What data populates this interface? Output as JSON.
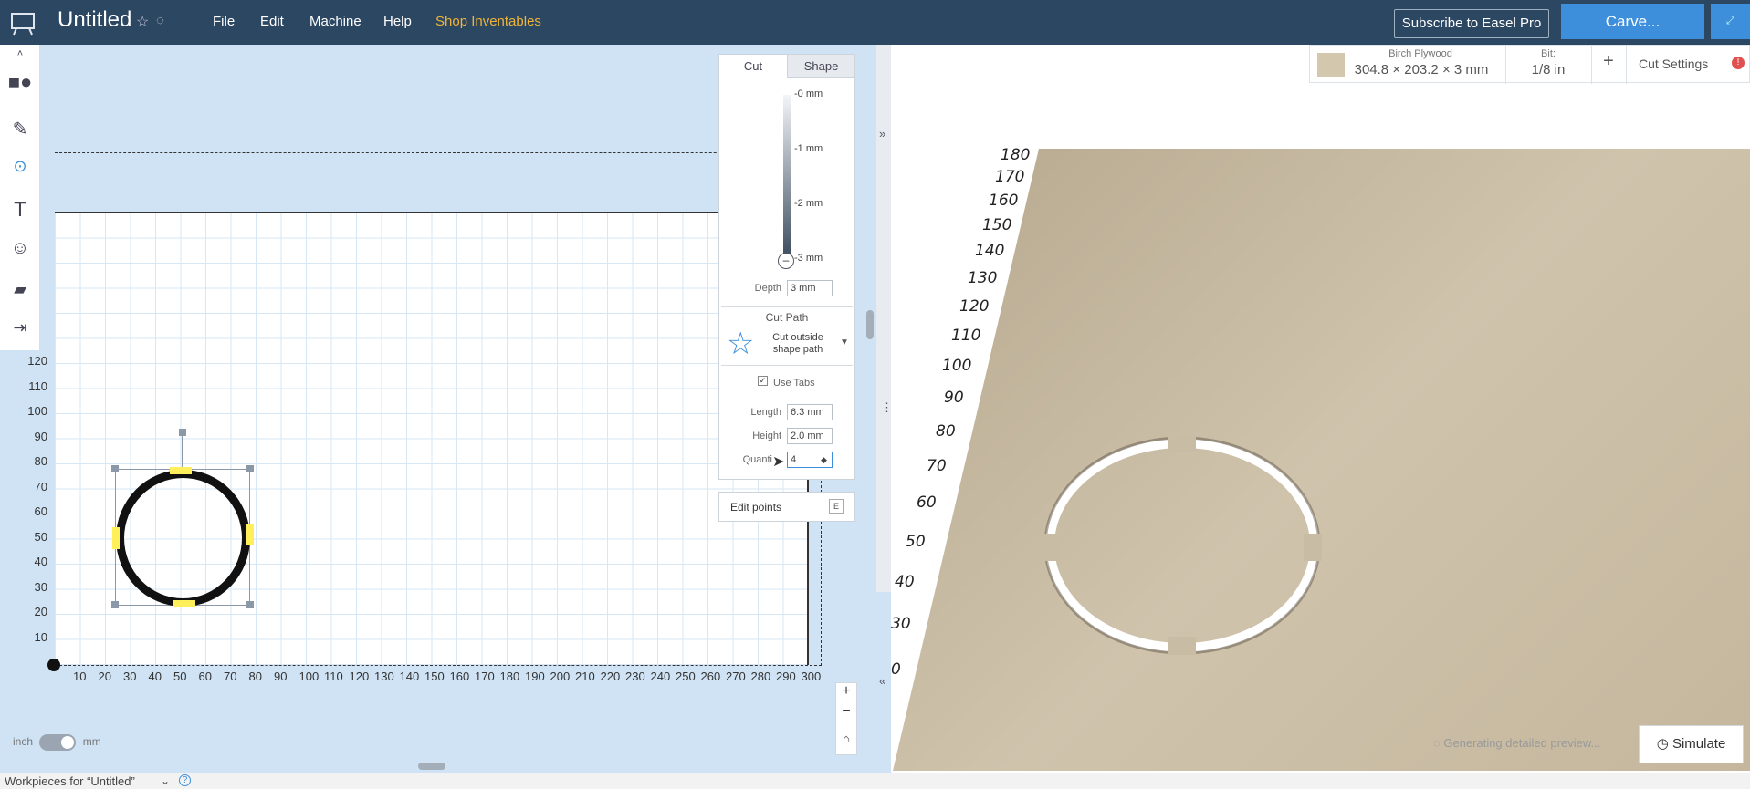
{
  "header": {
    "title": "Untitled",
    "menu": [
      "File",
      "Edit",
      "Machine",
      "Help",
      "Shop Inventables"
    ],
    "subscribe": "Subscribe to Easel Pro",
    "carve": "Carve..."
  },
  "canvas": {
    "y_ticks": [
      "120",
      "110",
      "100",
      "90",
      "80",
      "70",
      "60",
      "50",
      "40",
      "30",
      "20",
      "10"
    ],
    "x_ticks": [
      "10",
      "20",
      "30",
      "40",
      "50",
      "60",
      "70",
      "80",
      "90",
      "100",
      "110",
      "120",
      "130",
      "140",
      "150",
      "160",
      "170",
      "180",
      "190",
      "200",
      "210",
      "220",
      "230",
      "240",
      "250",
      "260",
      "270",
      "280",
      "290",
      "300"
    ]
  },
  "panel": {
    "tabs": [
      "Cut",
      "Shape"
    ],
    "depth_labels": [
      "-0 mm",
      "-1 mm",
      "-2 mm",
      "-3 mm"
    ],
    "depth_label": "Depth",
    "depth_value": "3 mm",
    "cut_path_title": "Cut Path",
    "cut_path_option_line1": "Cut outside",
    "cut_path_option_line2": "shape path",
    "use_tabs": "Use Tabs",
    "length_label": "Length",
    "length_value": "6.3 mm",
    "height_label": "Height",
    "height_value": "2.0 mm",
    "quantity_label": "Quanti",
    "quantity_value": "4",
    "edit_points": "Edit points",
    "edit_points_key": "E"
  },
  "preview": {
    "material_name": "Birch Plywood",
    "material_dims": "304.8 × 203.2 × 3 mm",
    "bit_label": "Bit:",
    "bit_value": "1/8 in",
    "cut_settings": "Cut Settings",
    "generating": "Generating detailed preview...",
    "simulate": "Simulate",
    "y_ticks": [
      "180",
      "170",
      "160",
      "150",
      "140",
      "130",
      "120",
      "110",
      "100",
      "90",
      "80",
      "70",
      "60",
      "50",
      "40",
      "30",
      "0"
    ]
  },
  "footer": {
    "units_inch": "inch",
    "units_mm": "mm",
    "workpieces": "Workpieces for “Untitled”"
  }
}
